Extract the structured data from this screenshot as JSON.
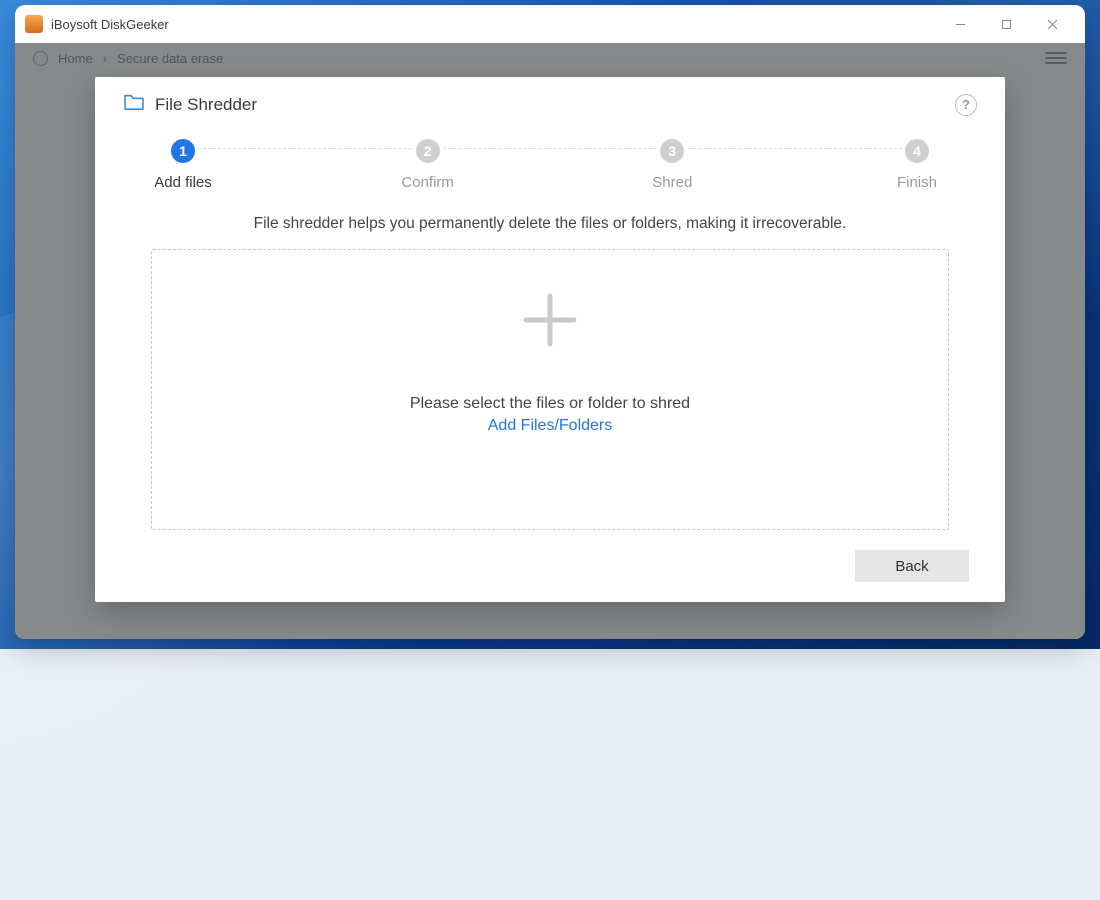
{
  "titlebar": {
    "app_title": "iBoysoft DiskGeeker"
  },
  "breadcrumb": {
    "home_label": "Home",
    "section_label": "Secure data erase"
  },
  "modal": {
    "title": "File Shredder",
    "help_symbol": "?",
    "description": "File shredder helps you permanently delete the files or folders, making it irrecoverable.",
    "dropzone": {
      "prompt": "Please select the files or folder to shred",
      "link_label": "Add Files/Folders"
    },
    "back_label": "Back"
  },
  "steps": [
    {
      "num": "1",
      "label": "Add files",
      "active": true
    },
    {
      "num": "2",
      "label": "Confirm",
      "active": false
    },
    {
      "num": "3",
      "label": "Shred",
      "active": false
    },
    {
      "num": "4",
      "label": "Finish",
      "active": false
    }
  ]
}
